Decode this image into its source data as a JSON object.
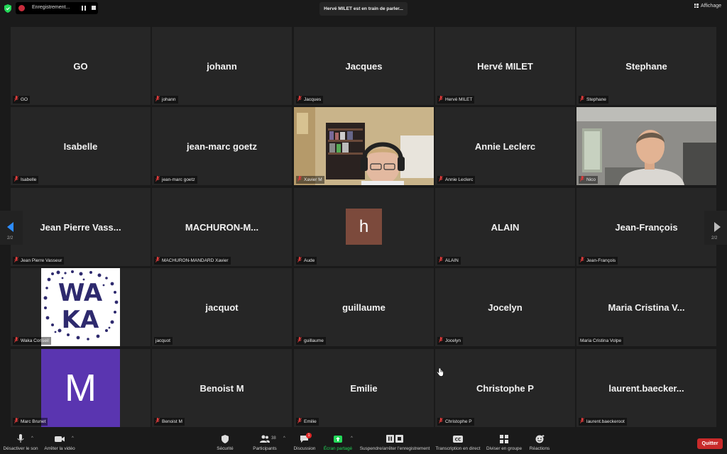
{
  "topbar": {
    "recording_label": "Enregistrement...",
    "speaker_banner": "Hervé MILET est en train de parler...",
    "view_label": "Affichage"
  },
  "tiles": [
    {
      "name": "GO",
      "label": "GO"
    },
    {
      "name": "johann",
      "label": "johann"
    },
    {
      "name": "Jacques",
      "label": "Jacques"
    },
    {
      "name": "Hervé MILET",
      "label": "Hervé MILET"
    },
    {
      "name": "Stephane",
      "label": "Stephane"
    },
    {
      "name": "Isabelle",
      "label": "Isabelle"
    },
    {
      "name": "jean-marc goetz",
      "label": "jean-marc goetz"
    },
    {
      "name": "",
      "label": "Xavier M"
    },
    {
      "name": "Annie Leclerc",
      "label": "Annie Leclerc"
    },
    {
      "name": "",
      "label": "Nico"
    },
    {
      "name": "Jean Pierre Vass...",
      "label": "Jean Pierre Vasseur"
    },
    {
      "name": "MACHURON-M...",
      "label": "MACHURON-MANDARD Xavier"
    },
    {
      "name": "",
      "label": "Aude",
      "avatar_letter": "h"
    },
    {
      "name": "ALAIN",
      "label": "ALAIN"
    },
    {
      "name": "Jean-François",
      "label": "Jean-François"
    },
    {
      "name": "",
      "label": "Waka Conseil",
      "logo_text": [
        "WA",
        "KA"
      ]
    },
    {
      "name": "jacquot",
      "label": "jacquot"
    },
    {
      "name": "guillaume",
      "label": "guillaume"
    },
    {
      "name": "Jocelyn",
      "label": "Jocelyn"
    },
    {
      "name": "Maria Cristina V...",
      "label": "Maria Cristina Volpe"
    },
    {
      "name": "",
      "label": "Marc Brunet",
      "avatar_letter": "M"
    },
    {
      "name": "Benoist M",
      "label": "Benoist M"
    },
    {
      "name": "Emilie",
      "label": "Emilie"
    },
    {
      "name": "Christophe P",
      "label": "Christophe P"
    },
    {
      "name": "laurent.baecker...",
      "label": "laurent.baeckeroot"
    }
  ],
  "pagination": {
    "left": "2/2",
    "right": "2/2"
  },
  "toolbar": {
    "mute": "Désactiver le son",
    "video": "Arrêter la vidéo",
    "security": "Sécurité",
    "participants": "Participants",
    "participants_count": "38",
    "chat": "Discussion",
    "chat_badge": "1",
    "share": "Écran partagé",
    "record": "Suspendre/arrêter l'enregistrement",
    "captions": "Transcription en direct",
    "breakout": "Diviser en groupe",
    "reactions": "Réactions",
    "quit": "Quitter"
  },
  "colors": {
    "accent_blue": "#2d8cff",
    "share_green": "#23d959",
    "quit_red": "#c82a2a",
    "tile_bg": "#262626",
    "muted_red": "#e03c3c"
  }
}
